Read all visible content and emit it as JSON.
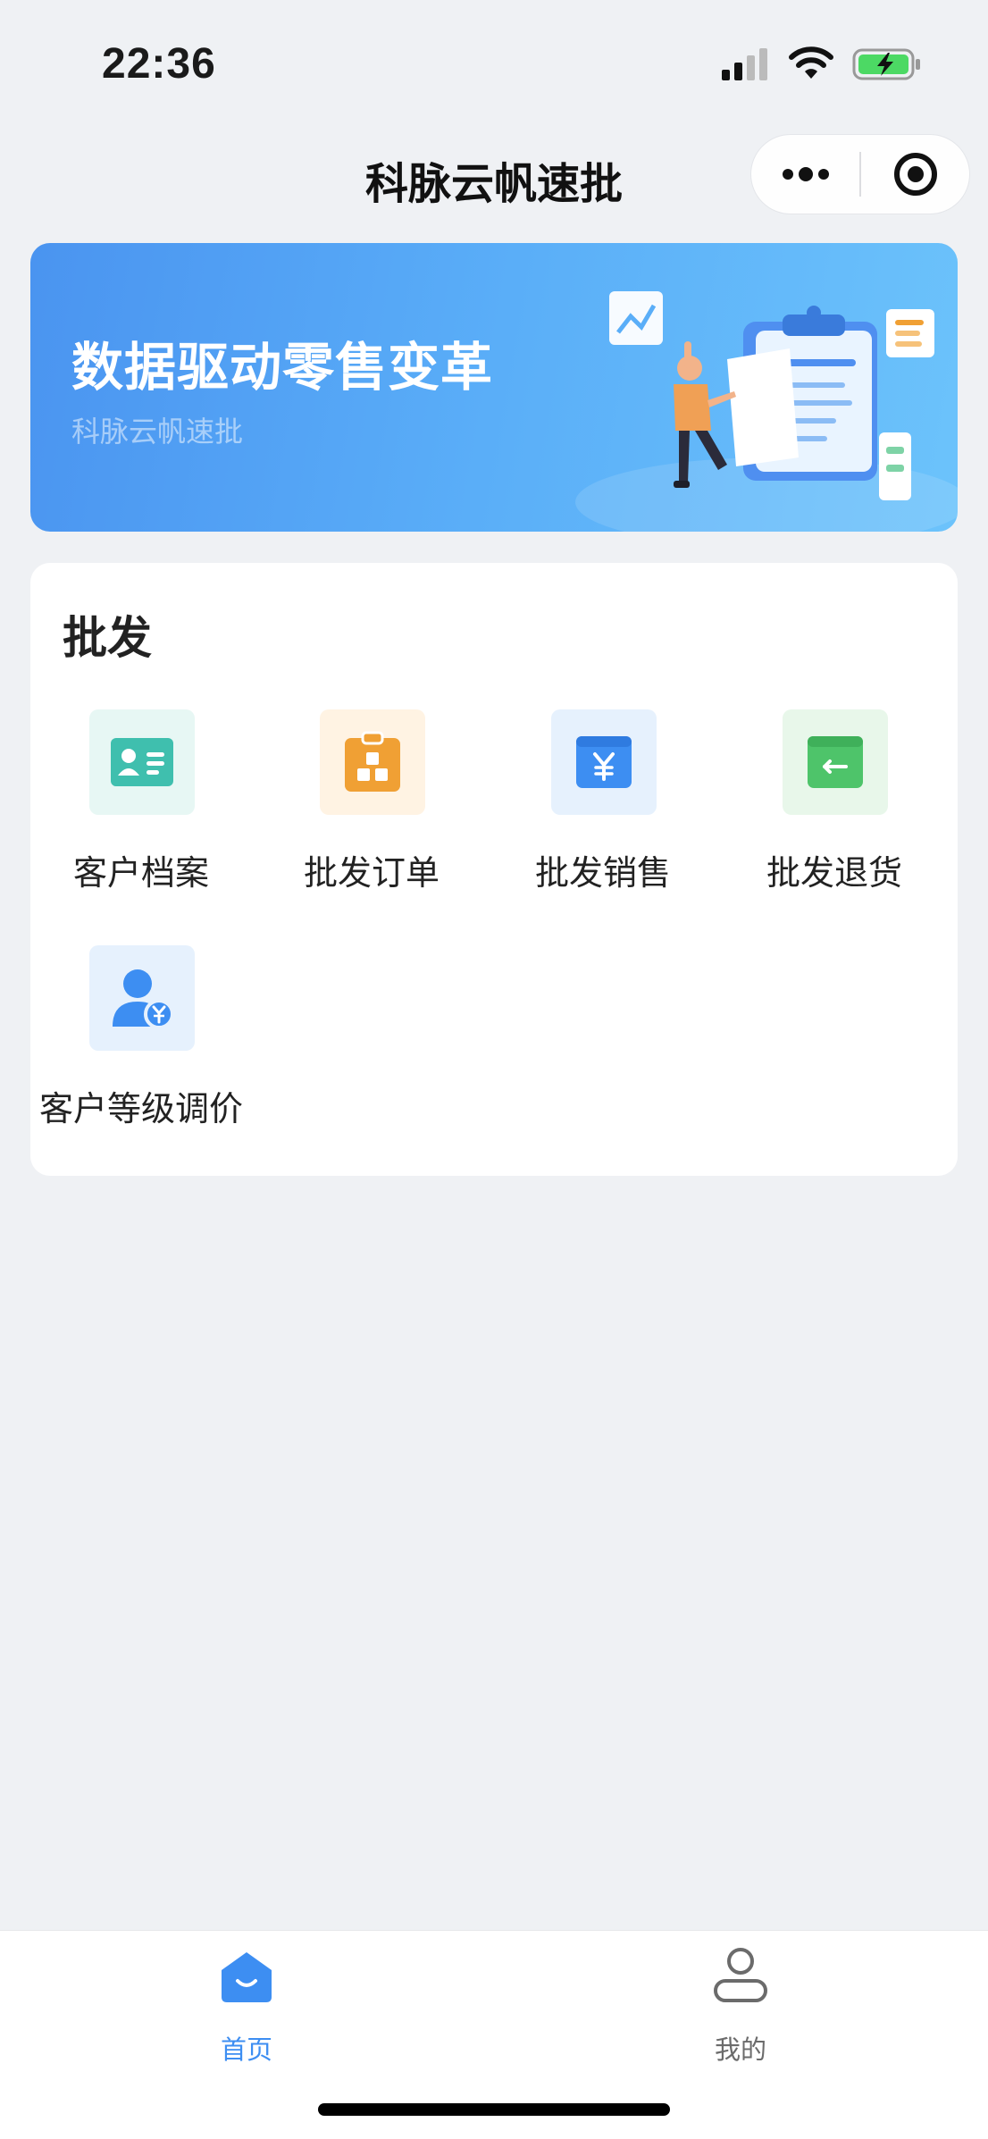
{
  "status": {
    "time": "22:36",
    "battery_color": "#4cd964"
  },
  "nav": {
    "title": "科脉云帆速批"
  },
  "banner": {
    "title": "数据驱动零售变革",
    "subtitle": "科脉云帆速批"
  },
  "section": {
    "title": "批发",
    "items": [
      {
        "label": "客户档案",
        "icon": "customer-card-icon",
        "color": "#3fbfae",
        "bg": "#e7f7f4"
      },
      {
        "label": "批发订单",
        "icon": "clipboard-order-icon",
        "color": "#f0a034",
        "bg": "#fff3e3"
      },
      {
        "label": "批发销售",
        "icon": "yen-box-icon",
        "color": "#3d8ef2",
        "bg": "#e6f1fd"
      },
      {
        "label": "批发退货",
        "icon": "return-box-icon",
        "color": "#4ec46a",
        "bg": "#e8f7ea"
      },
      {
        "label": "客户等级调价",
        "icon": "customer-price-icon",
        "color": "#3d8ef2",
        "bg": "#e6f1fd"
      }
    ]
  },
  "tabbar": {
    "tabs": [
      {
        "label": "首页",
        "icon": "home-icon",
        "active": true,
        "color": "#3d8ef2"
      },
      {
        "label": "我的",
        "icon": "user-icon",
        "active": false,
        "color": "#6b6b6b"
      }
    ]
  }
}
